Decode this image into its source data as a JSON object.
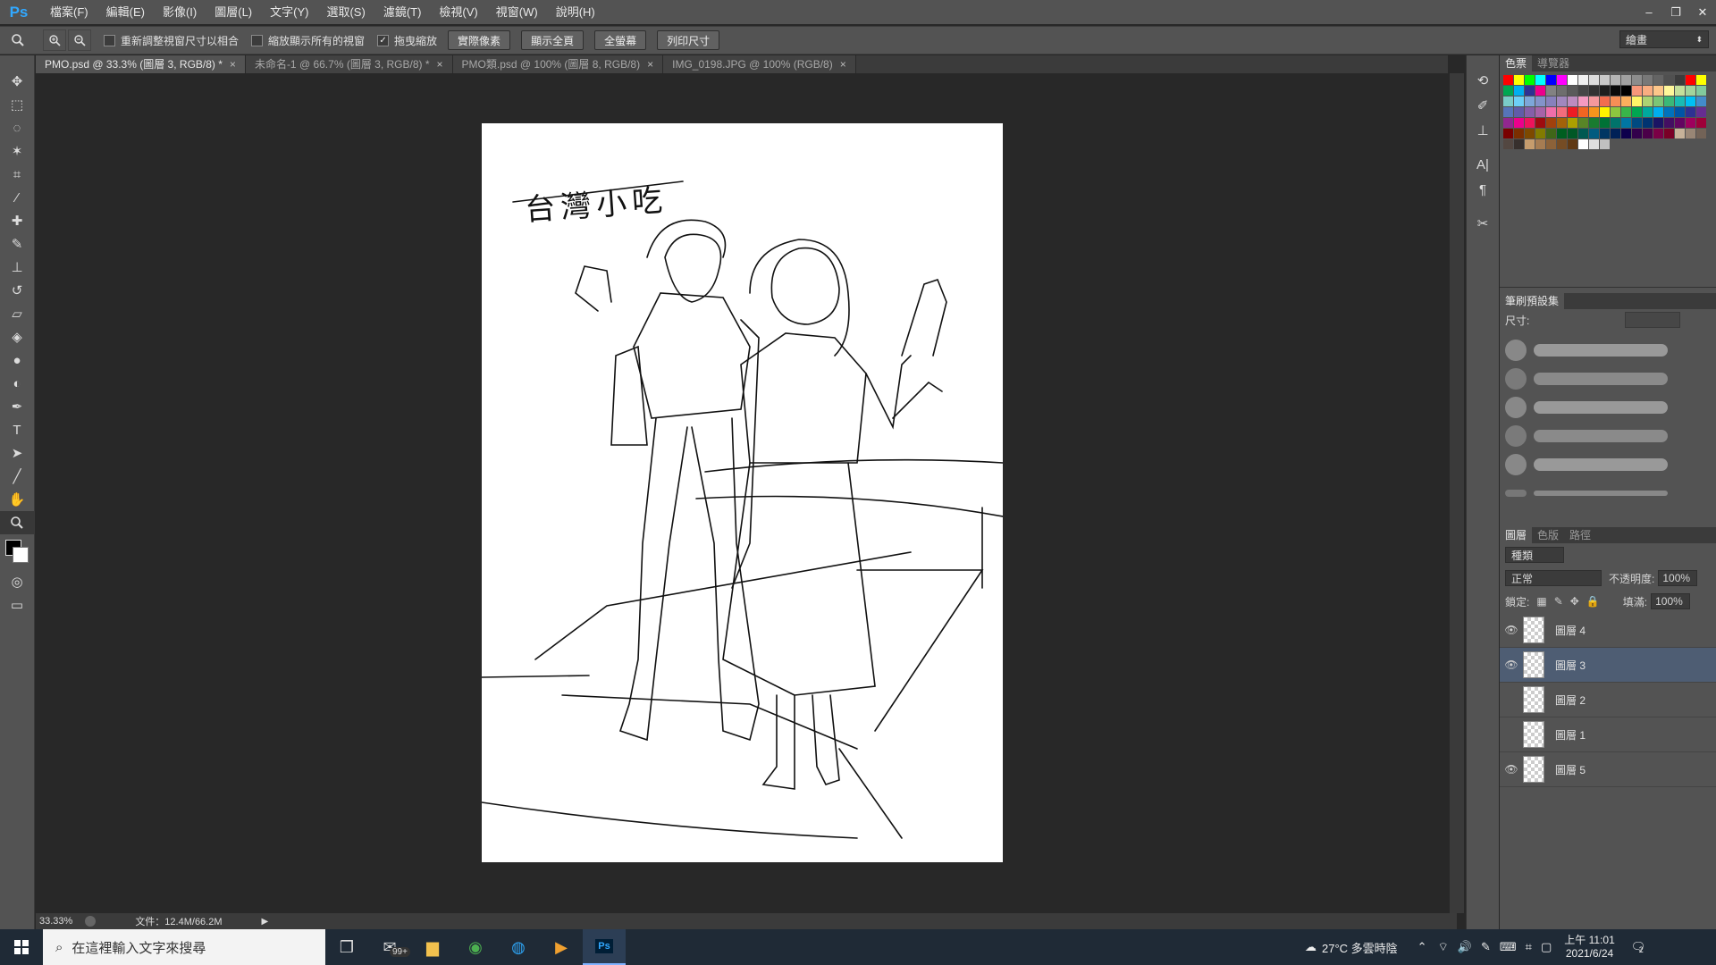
{
  "app": {
    "logo": "Ps"
  },
  "menu": [
    "檔案(F)",
    "編輯(E)",
    "影像(I)",
    "圖層(L)",
    "文字(Y)",
    "選取(S)",
    "濾鏡(T)",
    "檢視(V)",
    "視窗(W)",
    "說明(H)"
  ],
  "window_controls": {
    "minimize": "–",
    "restore": "❐",
    "close": "✕"
  },
  "options": {
    "tool_icon": "zoom-icon",
    "resize_windows_label": "重新調整視窗尺寸以相合",
    "zoom_all_label": "縮放顯示所有的視窗",
    "scrubby_zoom_label": "拖曳縮放",
    "scrubby_zoom_checked": "✓",
    "actual_pixels": "實際像素",
    "fit_screen": "顯示全頁",
    "fill_screen": "全螢幕",
    "print_size": "列印尺寸",
    "workspace": "繪畫"
  },
  "tabs": [
    {
      "label": "PMO.psd @ 33.3% (圖層 3, RGB/8) *",
      "close": "×"
    },
    {
      "label": "未命名-1 @ 66.7% (圖層 3, RGB/8) *",
      "close": "×"
    },
    {
      "label": "PMO類.psd @ 100% (圖層 8, RGB/8)",
      "close": "×"
    },
    {
      "label": "IMG_0198.JPG @ 100% (RGB/8)",
      "close": "×"
    }
  ],
  "canvas": {
    "sketch_title": "台灣小吃"
  },
  "status": {
    "zoom": "33.33%",
    "doc_size": "文件：12.4M/66.2M",
    "arrow": "▶"
  },
  "panels": {
    "swatches_tab": "色票",
    "navigator_tab": "導覽器",
    "brush_presets_tab": "筆刷預設集",
    "size_label": "尺寸:",
    "layers_tab": "圖層",
    "channels_tab": "色版",
    "paths_tab": "路徑",
    "filter_kind": "種類",
    "blend_mode": "正常",
    "opacity_label": "不透明度:",
    "opacity_value": "100%",
    "lock_label": "鎖定:",
    "fill_label": "填滿:",
    "fill_value": "100%",
    "layers": [
      {
        "name": "圖層 4",
        "visible": "👁"
      },
      {
        "name": "圖層 3",
        "visible": "👁"
      },
      {
        "name": "圖層 2",
        "visible": ""
      },
      {
        "name": "圖層 1",
        "visible": ""
      },
      {
        "name": "圖層 5",
        "visible": "👁"
      }
    ]
  },
  "taskbar": {
    "search_placeholder": "在這裡輸入文字來搜尋",
    "mail_badge": "99+",
    "weather": "27°C  多雲時陰",
    "time": "上午 11:01",
    "date": "2021/6/24",
    "notifications": "2"
  },
  "swatch_colors": [
    "#ff0000",
    "#ffff00",
    "#00ff00",
    "#00ffff",
    "#0000ff",
    "#ff00ff",
    "#ffffff",
    "#f0f0f0",
    "#dcdcdc",
    "#c8c8c8",
    "#b4b4b4",
    "#a0a0a0",
    "#8c8c8c",
    "#787878",
    "#646464",
    "#505050",
    "#3c3c3c",
    "#ff0000",
    "#ffff00",
    "#00a651",
    "#00aeef",
    "#2e3192",
    "#ec008c",
    "#828282",
    "#6e6e6e",
    "#5a5a5a",
    "#464646",
    "#323232",
    "#1e1e1e",
    "#0a0a0a",
    "#000000",
    "#f7977a",
    "#f9ad81",
    "#fdc68a",
    "#fff79a",
    "#c4df9b",
    "#a3d39c",
    "#82ca9d",
    "#7accc8",
    "#6dcff6",
    "#7da7d9",
    "#8393ca",
    "#8781bd",
    "#a187be",
    "#bd8cbf",
    "#f49ac1",
    "#f5989d",
    "#f26c4f",
    "#f68e56",
    "#fbaf5d",
    "#fff568",
    "#acd373",
    "#7cc576",
    "#3bb878",
    "#1abbb4",
    "#00bff3",
    "#438ccb",
    "#5674b9",
    "#605ca8",
    "#855fa8",
    "#a763a8",
    "#f06eaa",
    "#f26d7d",
    "#ed1c24",
    "#f26522",
    "#f7941d",
    "#fff200",
    "#8dc63f",
    "#39b54a",
    "#00a651",
    "#00a99d",
    "#00aeef",
    "#0072bc",
    "#0054a6",
    "#2e3192",
    "#662d91",
    "#92278f",
    "#ec008c",
    "#ed145b",
    "#9e0b0f",
    "#a0410d",
    "#a36209",
    "#aba000",
    "#598527",
    "#197b30",
    "#007236",
    "#00746b",
    "#0076a3",
    "#004a80",
    "#003471",
    "#1b1464",
    "#440e62",
    "#630460",
    "#9e005d",
    "#9e0039",
    "#790000",
    "#7b2e00",
    "#7d4900",
    "#827b00",
    "#406618",
    "#005e20",
    "#005826",
    "#005952",
    "#005b7f",
    "#003663",
    "#002157",
    "#0d004c",
    "#32004b",
    "#4b0049",
    "#7b0046",
    "#7a0026",
    "#c7b299",
    "#998675",
    "#736357",
    "#534741",
    "#37302d",
    "#c69c6d",
    "#a67c52",
    "#8c6239",
    "#754c24",
    "#603913",
    "#ffffff",
    "#e0e0e0",
    "#c0c0c0"
  ]
}
